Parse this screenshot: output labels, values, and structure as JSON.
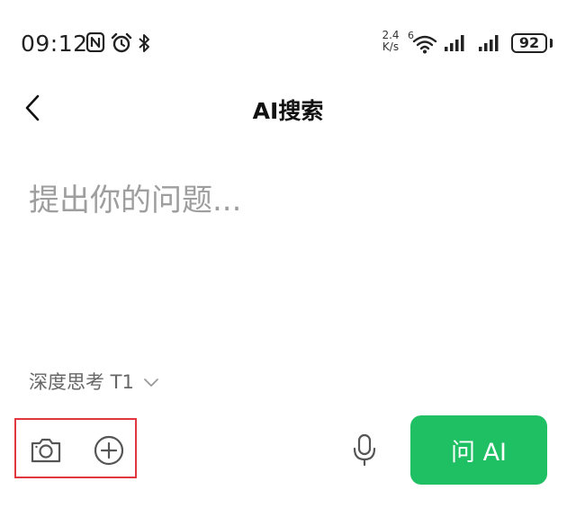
{
  "status_bar": {
    "time": "09:12",
    "net_speed_value": "2.4",
    "net_speed_unit": "K/s",
    "wifi_label": "6",
    "battery": "92",
    "icons": [
      "nfc-icon",
      "alarm-icon",
      "bluetooth-icon",
      "wifi-icon",
      "signal-icon",
      "signal-icon",
      "battery-icon"
    ]
  },
  "header": {
    "title": "AI搜索",
    "back_icon": "chevron-left-icon"
  },
  "composer": {
    "placeholder": "提出你的问题...",
    "mode_label": "深度思考 T1"
  },
  "toolbar": {
    "camera_icon": "camera-icon",
    "add_icon": "plus-circle-icon",
    "mic_icon": "microphone-icon",
    "ask_label": "问 AI",
    "ask_color": "#1fbf63",
    "highlight_color": "#e0383e"
  }
}
